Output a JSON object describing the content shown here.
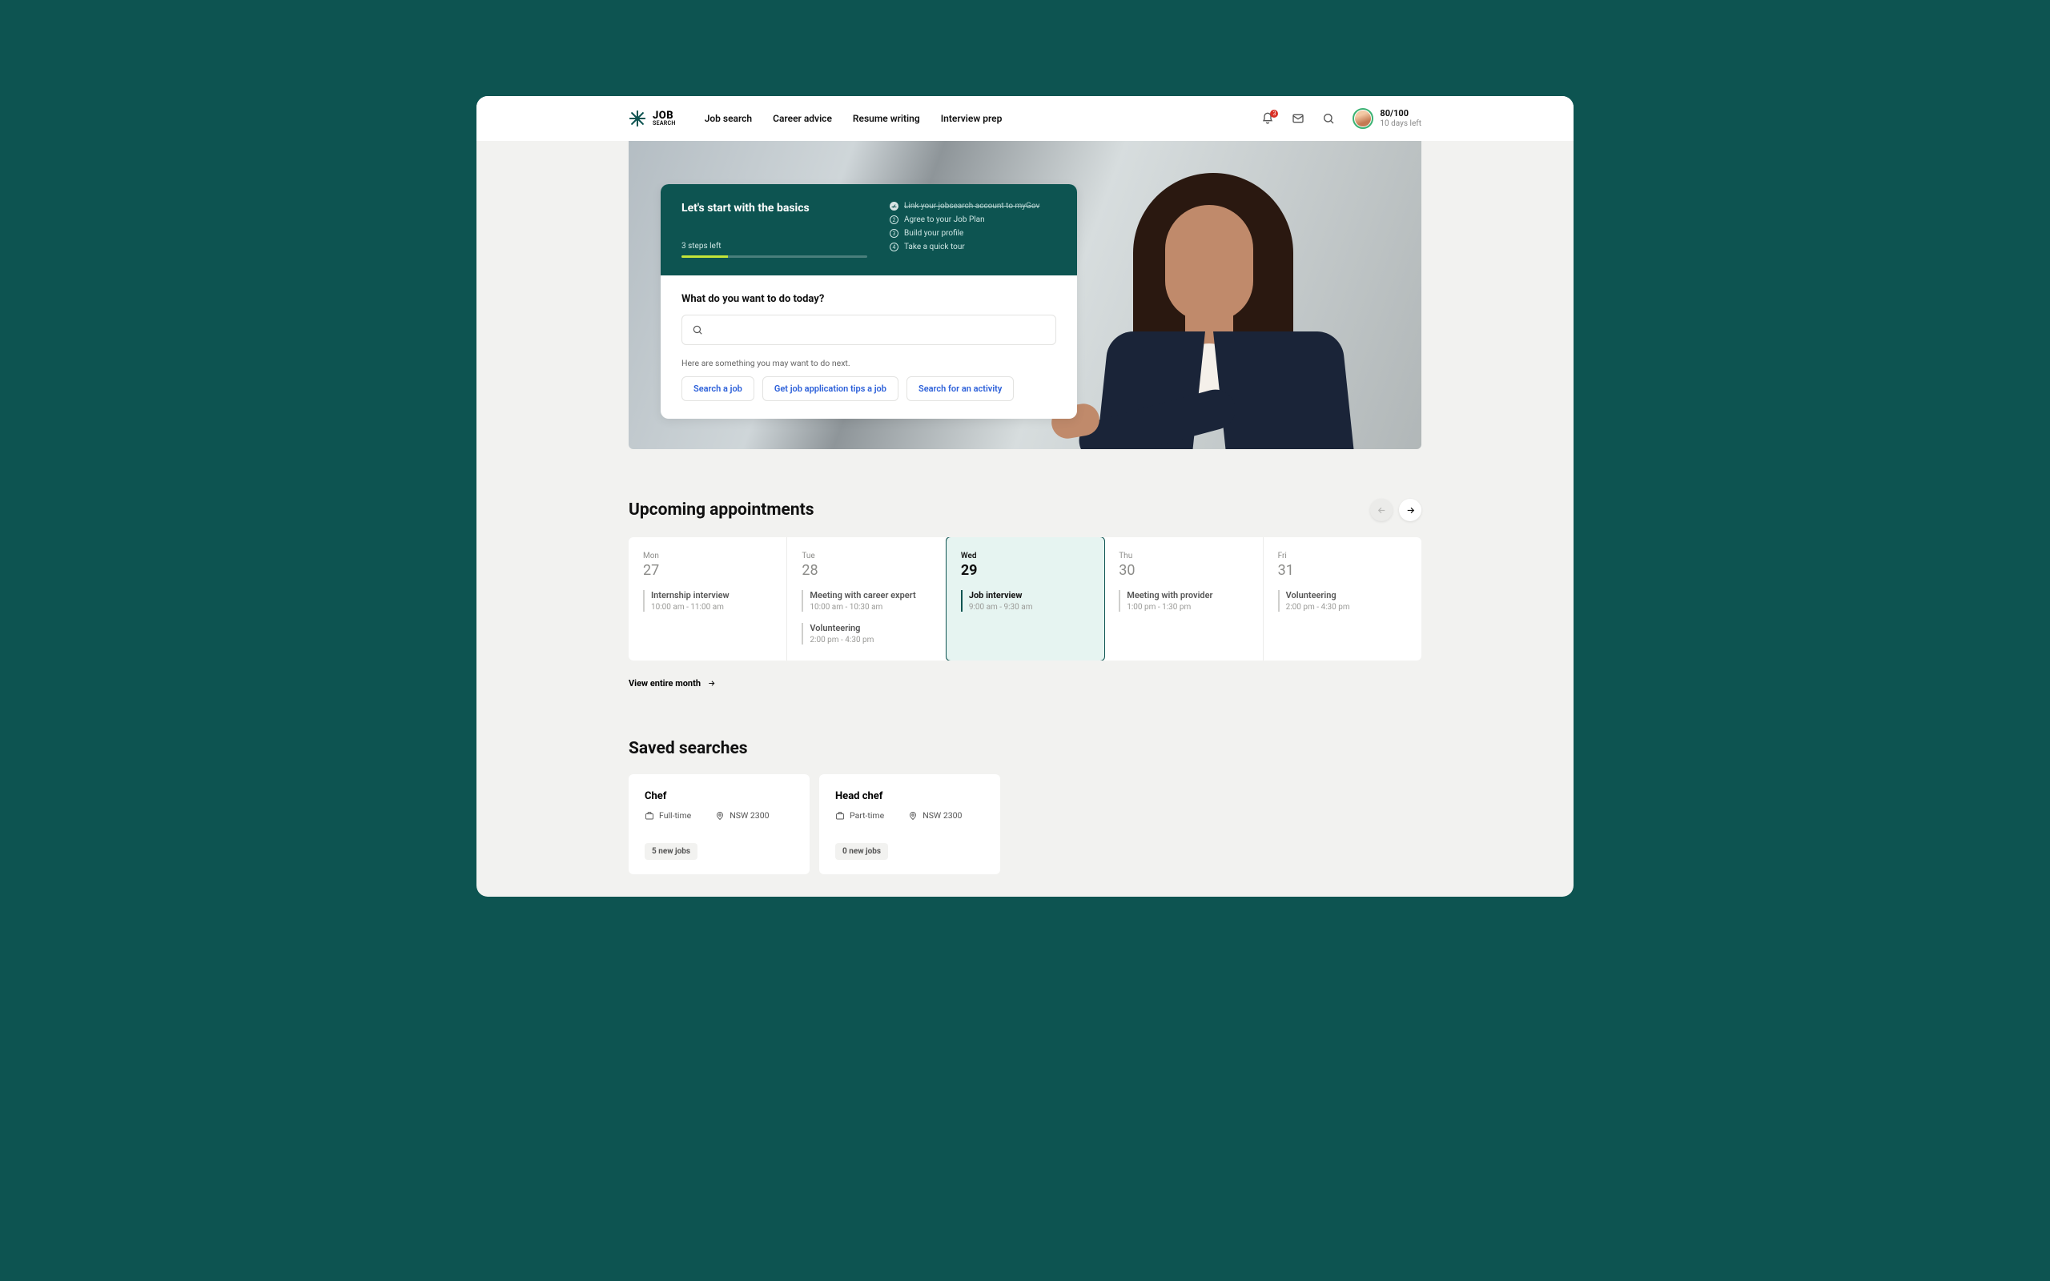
{
  "brand": {
    "line1": "JOB",
    "line2": "SEARCH"
  },
  "nav": [
    "Job search",
    "Career advice",
    "Resume writing",
    "Interview prep"
  ],
  "notif_count": "3",
  "profile": {
    "score": "80/100",
    "days": "10 days left"
  },
  "basics": {
    "title": "Let's start with the basics",
    "steps_left": "3 steps left",
    "checklist": [
      {
        "label": "Link your jobsearch account to myGov",
        "done": true
      },
      {
        "label": "Agree to your Job Plan",
        "done": false,
        "num": "2"
      },
      {
        "label": "Build your profile",
        "done": false,
        "num": "3"
      },
      {
        "label": "Take a quick tour",
        "done": false,
        "num": "4"
      }
    ]
  },
  "search": {
    "title": "What do you want to do today?",
    "placeholder": "",
    "hint": "Here are something you may want to do next.",
    "suggestions": [
      "Search a job",
      "Get job application tips a job",
      "Search for an activity"
    ]
  },
  "appointments": {
    "title": "Upcoming appointments",
    "view_month": "View entire month",
    "days": [
      {
        "name": "Mon",
        "num": "27",
        "active": false,
        "events": [
          {
            "title": "Internship interview",
            "time": "10:00 am - 11:00 am"
          }
        ]
      },
      {
        "name": "Tue",
        "num": "28",
        "active": false,
        "events": [
          {
            "title": "Meeting with career expert",
            "time": "10:00 am - 10:30 am"
          },
          {
            "title": "Volunteering",
            "time": "2:00 pm - 4:30 pm"
          }
        ]
      },
      {
        "name": "Wed",
        "num": "29",
        "active": true,
        "events": [
          {
            "title": "Job interview",
            "time": "9:00 am - 9:30 am"
          }
        ]
      },
      {
        "name": "Thu",
        "num": "30",
        "active": false,
        "events": [
          {
            "title": "Meeting with provider",
            "time": "1:00 pm - 1:30 pm"
          }
        ]
      },
      {
        "name": "Fri",
        "num": "31",
        "active": false,
        "events": [
          {
            "title": "Volunteering",
            "time": "2:00 pm - 4:30 pm"
          }
        ]
      }
    ]
  },
  "saved": {
    "title": "Saved searches",
    "cards": [
      {
        "title": "Chef",
        "type": "Full-time",
        "loc": "NSW 2300",
        "badge": "5 new jobs"
      },
      {
        "title": "Head chef",
        "type": "Part-time",
        "loc": "NSW 2300",
        "badge": "0 new jobs"
      }
    ]
  }
}
